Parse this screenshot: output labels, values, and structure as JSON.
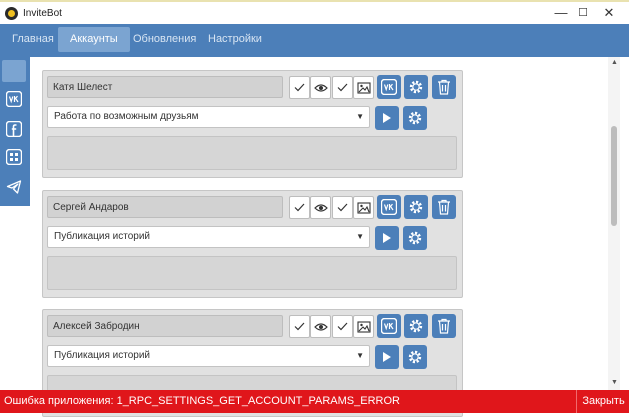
{
  "window": {
    "title": "InviteBot",
    "controls": {
      "minimize": "—",
      "maximize": "☐",
      "close": "✕"
    }
  },
  "nav": {
    "tabs": [
      {
        "label": "Главная"
      },
      {
        "label": "Аккаунты",
        "active": true
      },
      {
        "label": "Обновления"
      },
      {
        "label": "Настройки"
      }
    ]
  },
  "sidebar": {
    "items": [
      {
        "icon": "vk-icon"
      },
      {
        "icon": "facebook-icon"
      },
      {
        "icon": "odnoklassniki-icon"
      },
      {
        "icon": "telegram-icon"
      }
    ]
  },
  "accounts": [
    {
      "name": "Катя Шелест",
      "task": "Работа по возможным друзьям"
    },
    {
      "name": "Сергей Андаров",
      "task": "Публикация историй"
    },
    {
      "name": "Алексей Забродин",
      "task": "Публикация историй"
    }
  ],
  "error_bar": {
    "message": "Ошибка приложения: 1_RPC_SETTINGS_GET_ACCOUNT_PARAMS_ERROR",
    "close_label": "Закрыть"
  },
  "colors": {
    "accent": "#4c7fb9",
    "accent_light": "#7ba4d1",
    "error": "#e0161b"
  }
}
